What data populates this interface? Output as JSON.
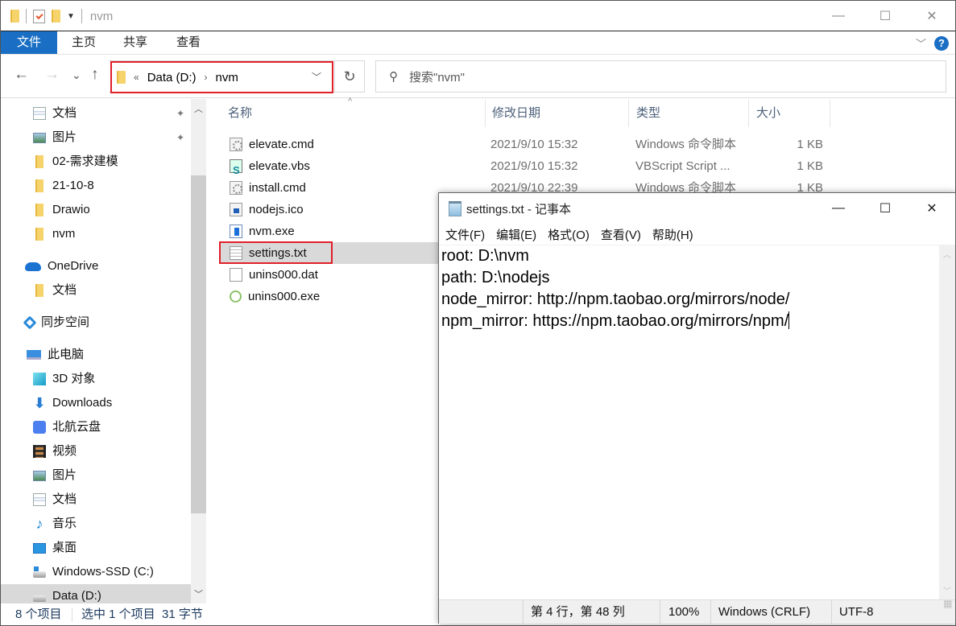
{
  "explorer": {
    "title": "nvm",
    "window_controls": {
      "minimize": "—",
      "maximize": "☐",
      "close": "✕"
    },
    "ribbon": {
      "tabs": [
        "文件",
        "主页",
        "共享",
        "查看"
      ],
      "expand_icon": "chevron-down-icon",
      "help_label": "?"
    },
    "nav": {
      "back": "←",
      "forward": "→",
      "recent": "⌄",
      "up": "↑",
      "breadcrumb": {
        "overflow": "«",
        "items": [
          "Data (D:)",
          "nvm"
        ],
        "separator": "›"
      },
      "refresh": "↻",
      "search_placeholder": "搜索\"nvm\""
    },
    "sidebar": {
      "items": [
        {
          "label": "文档",
          "icon": "documents-icon",
          "pinned": true
        },
        {
          "label": "图片",
          "icon": "pictures-icon",
          "pinned": true
        },
        {
          "label": "02-需求建模",
          "icon": "folder-icon"
        },
        {
          "label": "21-10-8",
          "icon": "folder-icon"
        },
        {
          "label": "Drawio",
          "icon": "folder-icon"
        },
        {
          "label": "nvm",
          "icon": "folder-icon"
        },
        {
          "label": "OneDrive",
          "icon": "onedrive-icon"
        },
        {
          "label": "文档",
          "icon": "folder-icon"
        },
        {
          "label": "同步空间",
          "icon": "sync-space-icon"
        },
        {
          "label": "此电脑",
          "icon": "this-pc-icon"
        },
        {
          "label": "3D 对象",
          "icon": "3d-objects-icon"
        },
        {
          "label": "Downloads",
          "icon": "downloads-icon"
        },
        {
          "label": "北航云盘",
          "icon": "buaa-cloud-icon"
        },
        {
          "label": "视频",
          "icon": "videos-icon"
        },
        {
          "label": "图片",
          "icon": "pictures-icon"
        },
        {
          "label": "文档",
          "icon": "documents-icon"
        },
        {
          "label": "音乐",
          "icon": "music-icon"
        },
        {
          "label": "桌面",
          "icon": "desktop-icon"
        },
        {
          "label": "Windows-SSD (C:)",
          "icon": "drive-c-icon"
        },
        {
          "label": "Data (D:)",
          "icon": "drive-icon",
          "selected": true
        }
      ],
      "pin_glyph": "📌"
    },
    "file_list": {
      "columns": [
        "名称",
        "修改日期",
        "类型",
        "大小"
      ],
      "rows": [
        {
          "name": "elevate.cmd",
          "date": "2021/9/10 15:32",
          "type": "Windows 命令脚本",
          "size": "1 KB",
          "icon": "cmd"
        },
        {
          "name": "elevate.vbs",
          "date": "2021/9/10 15:32",
          "type": "VBScript Script ...",
          "size": "1 KB",
          "icon": "vbs"
        },
        {
          "name": "install.cmd",
          "date": "2021/9/10 22:39",
          "type": "Windows 命令脚本",
          "size": "1 KB",
          "icon": "cmd"
        },
        {
          "name": "nodejs.ico",
          "date": "",
          "type": "",
          "size": "",
          "icon": "ico"
        },
        {
          "name": "nvm.exe",
          "date": "",
          "type": "",
          "size": "",
          "icon": "exe"
        },
        {
          "name": "settings.txt",
          "date": "",
          "type": "",
          "size": "",
          "icon": "txt",
          "selected": true
        },
        {
          "name": "unins000.dat",
          "date": "",
          "type": "",
          "size": "",
          "icon": "dat"
        },
        {
          "name": "unins000.exe",
          "date": "",
          "type": "",
          "size": "",
          "icon": "js"
        }
      ]
    },
    "status": {
      "item_count": "8 个项目",
      "selection": "选中 1 个项目  31 字节"
    }
  },
  "notepad": {
    "title": "settings.txt - 记事本",
    "window_controls": {
      "minimize": "—",
      "maximize": "☐",
      "close": "✕"
    },
    "menu": [
      "文件(F)",
      "编辑(E)",
      "格式(O)",
      "查看(V)",
      "帮助(H)"
    ],
    "content_lines": [
      "root: D:\\nvm",
      "path: D:\\nodejs",
      "node_mirror: http://npm.taobao.org/mirrors/node/",
      "npm_mirror: https://npm.taobao.org/mirrors/npm/"
    ],
    "status": {
      "position": "第 4 行，第 48 列",
      "zoom": "100%",
      "line_ending": "Windows (CRLF)",
      "encoding": "UTF-8"
    }
  }
}
